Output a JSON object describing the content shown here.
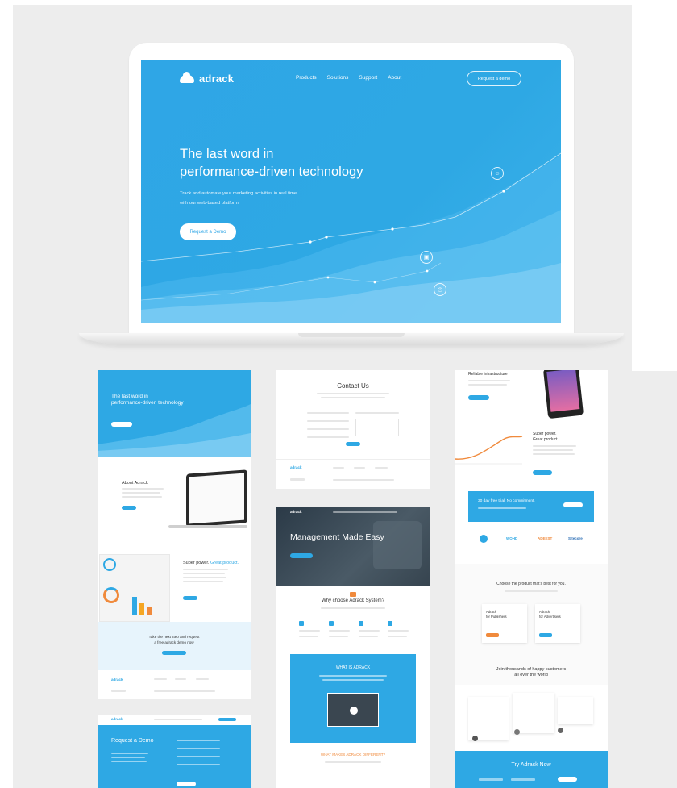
{
  "main_mockup": {
    "logo": "adrack",
    "nav": [
      "Products",
      "Solutions",
      "Support",
      "About"
    ],
    "cta": "Request a demo",
    "hero_title_l1": "The last word in",
    "hero_title_l2": "performance-driven technology",
    "hero_sub_l1": "Track and automate your marketing activities in real time",
    "hero_sub_l2": "with our web-based platform.",
    "hero_button": "Request a Demo"
  },
  "thumb_home": {
    "hero_l1": "The last word in",
    "hero_l2": "performance-driven technology",
    "about_title": "About Adrack",
    "super_title": "Super power.",
    "super_accent": "Great product.",
    "cta_l1": "Take the next step and request",
    "cta_l2": "a free adrack demo now",
    "logo": "adrack"
  },
  "thumb_request": {
    "logo": "adrack",
    "title": "Request a Demo"
  },
  "thumb_contact": {
    "logo": "adrack",
    "title": "Contact Us"
  },
  "thumb_system": {
    "logo": "adrack",
    "hero": "Management Made Easy",
    "why": "Why choose Adrack System?",
    "what": "WHAT IS ADRACK",
    "different": "WHAT MAKES ADRACK DIFFERENT?"
  },
  "thumb_products": {
    "reliable": "Reliable infrastructure",
    "super_l1": "Super power.",
    "super_l2": "Great product.",
    "trial": "30 day free trial. No commitment.",
    "brands": [
      "WOHD",
      "ADEEST",
      "Sitecore"
    ],
    "choose": "Choose the product that's best for you.",
    "pub_l1": "Adrack",
    "pub_l2": "for Publishers",
    "adv_l1": "Adrack",
    "adv_l2": "for Advertisers",
    "join_l1": "Join thousands of happy customers",
    "join_l2": "all over the world",
    "try": "Try Adrack Now"
  },
  "colors": {
    "brand": "#2ea8e4",
    "accent": "#f08a3c",
    "canvas": "#ededed"
  }
}
